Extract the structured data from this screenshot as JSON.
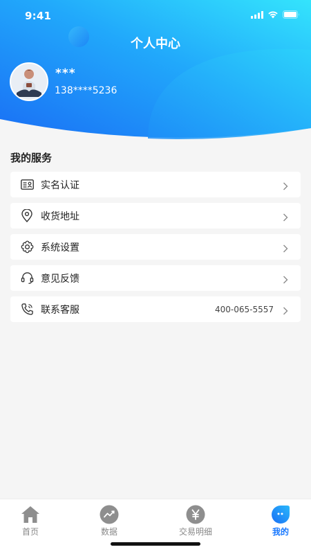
{
  "status_bar": {
    "time": "9:41"
  },
  "header": {
    "title": "个人中心",
    "nickname": "***",
    "phone": "138****5236"
  },
  "services": {
    "title": "我的服务",
    "items": [
      {
        "label": "实名认证",
        "icon": "id-card-icon"
      },
      {
        "label": "收货地址",
        "icon": "location-pin-icon"
      },
      {
        "label": "系统设置",
        "icon": "gear-icon"
      },
      {
        "label": "意见反馈",
        "icon": "headset-icon"
      },
      {
        "label": "联系客服",
        "icon": "phone-icon",
        "value": "400-065-5557"
      }
    ]
  },
  "tabbar": {
    "items": [
      {
        "label": "首页",
        "icon": "home-icon",
        "active": false
      },
      {
        "label": "数据",
        "icon": "chart-icon",
        "active": false
      },
      {
        "label": "交易明细",
        "icon": "yen-icon",
        "active": false
      },
      {
        "label": "我的",
        "icon": "profile-icon",
        "active": true
      }
    ]
  },
  "colors": {
    "header_gradient_start": "#1a7cf7",
    "header_gradient_end": "#2ee0fb",
    "accent": "#1677ff",
    "background": "#f5f5f5"
  }
}
